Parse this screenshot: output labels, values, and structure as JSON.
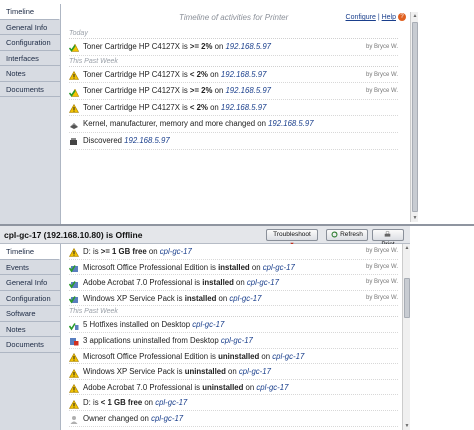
{
  "top": {
    "tabs": [
      "Timeline",
      "General Info",
      "Configuration",
      "Interfaces",
      "Notes",
      "Documents"
    ],
    "active_tab": 0,
    "timeline_title": "Timeline of activities for Printer",
    "configure_label": "Configure",
    "help_label": "Help",
    "groups": [
      {
        "label": "Today",
        "rows": [
          {
            "icon": "check-warning-icon",
            "pre": "Toner Cartridge HP C4127X",
            "mid": " is ",
            "bold": ">= 2%",
            "post": " on ",
            "ip": "192.168.5.97",
            "by": "by Bryce W."
          }
        ]
      },
      {
        "label": "This Past Week",
        "rows": [
          {
            "icon": "warning-icon",
            "pre": "Toner Cartridge HP C4127X",
            "mid": " is ",
            "bold": "< 2%",
            "post": " on ",
            "ip": "192.168.5.97",
            "by": "by Bryce W."
          },
          {
            "icon": "check-warning-icon",
            "pre": "Toner Cartridge HP C4127X",
            "mid": " is ",
            "bold": ">= 2%",
            "post": " on ",
            "ip": "192.168.5.97",
            "by": "by Bryce W."
          },
          {
            "icon": "warning-icon",
            "pre": "Toner Cartridge HP C4127X",
            "mid": " is ",
            "bold": "< 2%",
            "post": " on ",
            "ip": "192.168.5.97",
            "by": ""
          },
          {
            "icon": "change-icon",
            "pre": "Kernel, manufacturer, memory and more changed",
            "mid": "",
            "bold": "",
            "post": " on ",
            "ip": "192.168.5.97",
            "by": ""
          },
          {
            "icon": "discover-icon",
            "pre": "Discovered",
            "mid": "",
            "bold": "",
            "post": " ",
            "ip": "192.168.5.97",
            "by": ""
          }
        ]
      }
    ]
  },
  "bottom": {
    "title": "cpl-gc-17 (192.168.10.80) is Offline",
    "troubleshoot_label": "Troubleshoot",
    "refresh_label": "Refresh",
    "print_label": "Print",
    "tabs": [
      "Timeline",
      "Events",
      "General Info",
      "Configuration",
      "Software",
      "Notes",
      "Documents"
    ],
    "active_tab": 0,
    "rows": [
      {
        "icon": "warning-icon",
        "pre": "D:",
        "mid": " is ",
        "bold": ">= 1 GB free",
        "post": " on ",
        "ip": "cpl-gc-17",
        "by": "by Bryce W."
      },
      {
        "icon": "install-icon",
        "pre": "Microsoft Office Professional Edition",
        "mid": " is ",
        "bold": "installed",
        "post": " on ",
        "ip": "cpl-gc-17",
        "by": "by Bryce W."
      },
      {
        "icon": "install-icon",
        "pre": "Adobe Acrobat 7.0 Professional",
        "mid": " is ",
        "bold": "installed",
        "post": " on ",
        "ip": "cpl-gc-17",
        "by": "by Bryce W."
      },
      {
        "icon": "install-icon",
        "pre": "Windows XP Service Pack",
        "mid": " is ",
        "bold": "installed",
        "post": " on ",
        "ip": "cpl-gc-17",
        "by": "by Bryce W."
      }
    ],
    "group_label": "This Past Week",
    "rows2": [
      {
        "icon": "hotfix-icon",
        "pre": "5 Hotfixes installed on Desktop",
        "mid": "",
        "bold": "",
        "post": " ",
        "ip": "cpl-gc-17",
        "by": ""
      },
      {
        "icon": "uninstall-icon",
        "pre": "3 applications uninstalled from Desktop",
        "mid": "",
        "bold": "",
        "post": " ",
        "ip": "cpl-gc-17",
        "by": ""
      },
      {
        "icon": "warning-icon",
        "pre": "Microsoft Office Professional Edition",
        "mid": " is ",
        "bold": "uninstalled",
        "post": " on ",
        "ip": "cpl-gc-17",
        "by": ""
      },
      {
        "icon": "warning-icon",
        "pre": "Windows XP Service Pack",
        "mid": " is ",
        "bold": "uninstalled",
        "post": " on ",
        "ip": "cpl-gc-17",
        "by": ""
      },
      {
        "icon": "warning-icon",
        "pre": "Adobe Acrobat 7.0 Professional",
        "mid": " is ",
        "bold": "uninstalled",
        "post": " on ",
        "ip": "cpl-gc-17",
        "by": ""
      },
      {
        "icon": "warning-icon",
        "pre": "D:",
        "mid": " is ",
        "bold": "< 1 GB free",
        "post": " on ",
        "ip": "cpl-gc-17",
        "by": ""
      },
      {
        "icon": "owner-icon",
        "pre": "Owner changed",
        "mid": "",
        "bold": "",
        "post": " on ",
        "ip": "cpl-gc-17",
        "by": ""
      }
    ]
  }
}
